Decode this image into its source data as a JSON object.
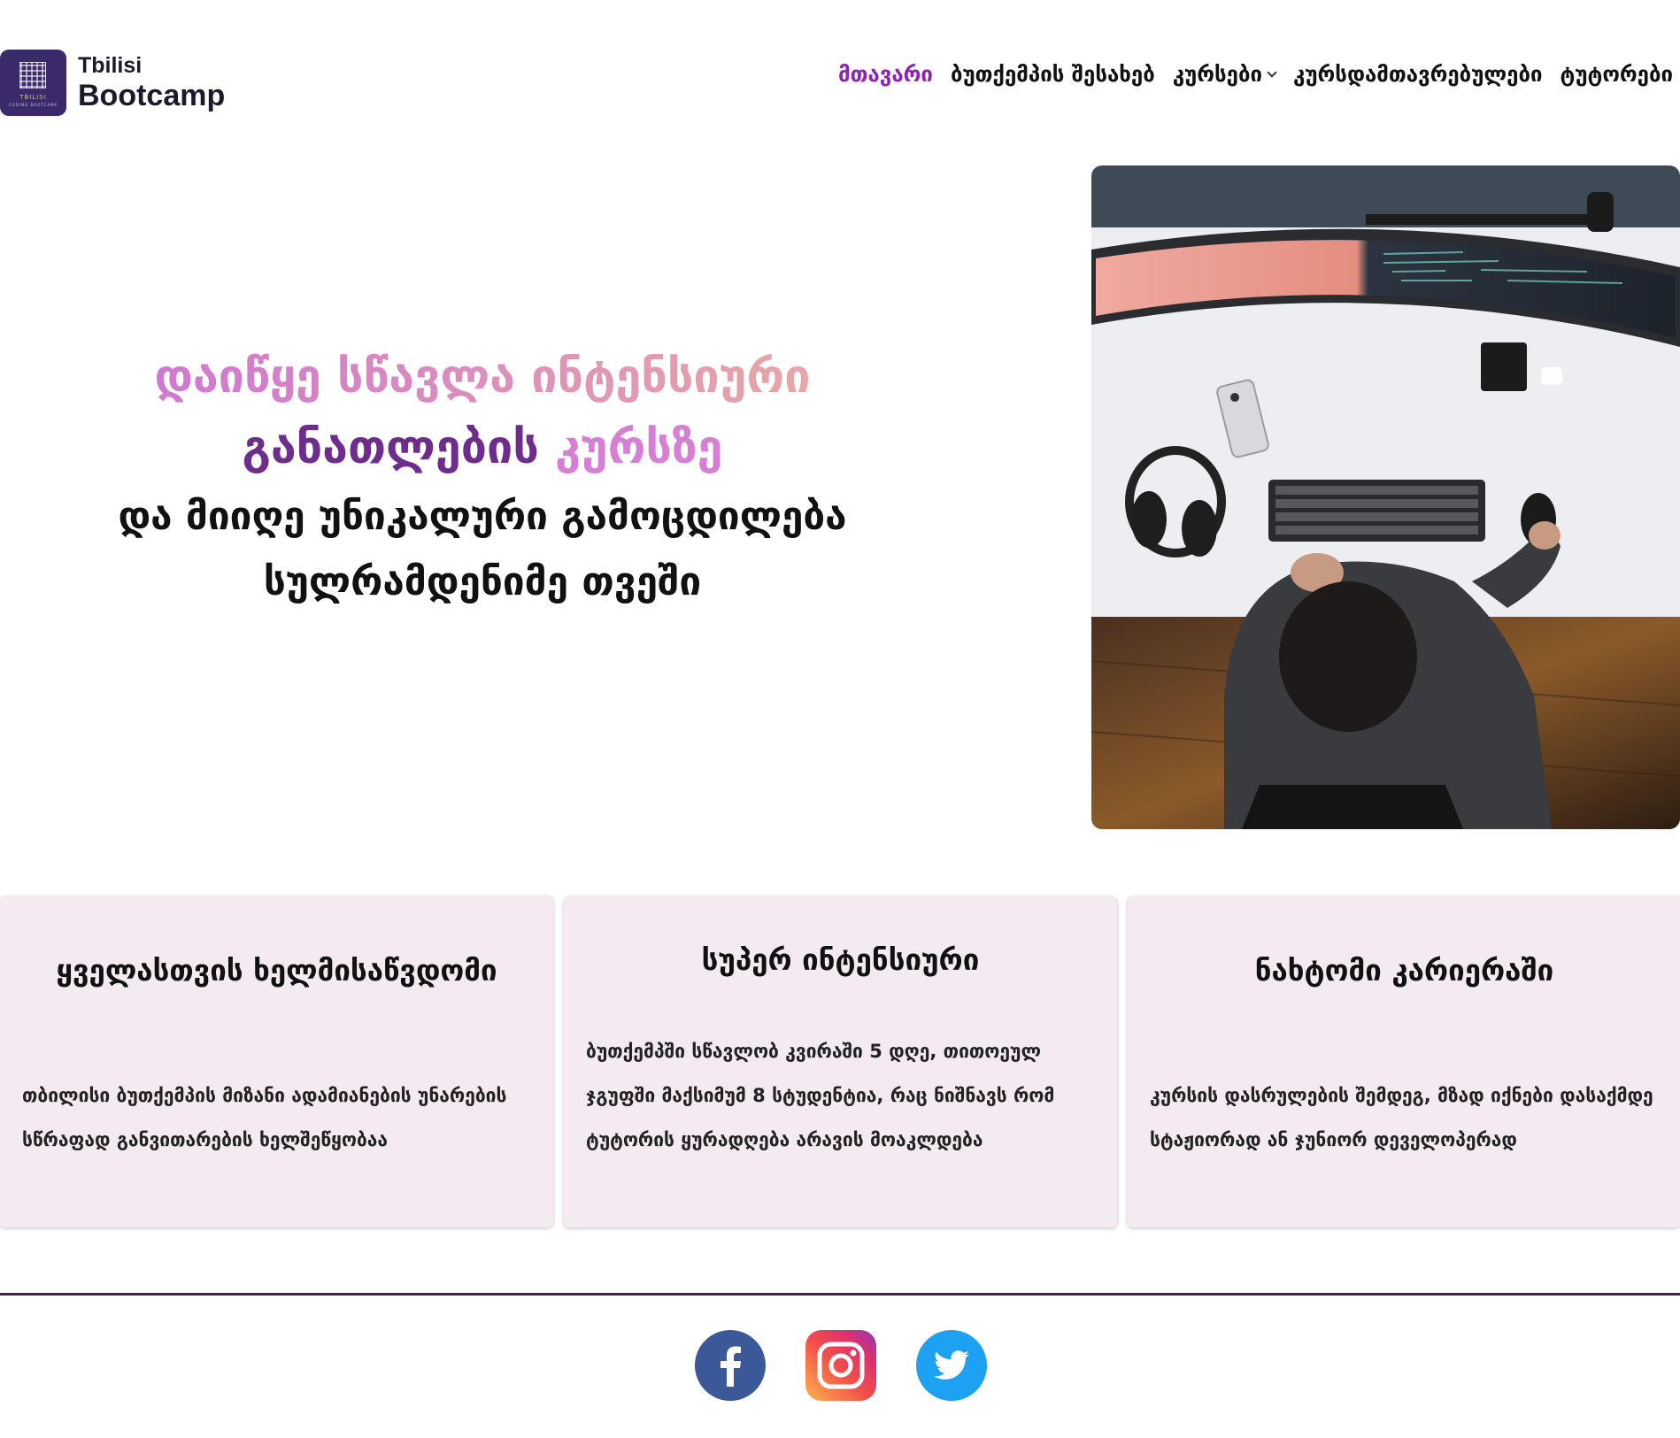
{
  "header": {
    "logo": {
      "line1": "Tbilisi",
      "line2": "Bootcamp",
      "badge_line1": "TBILISI",
      "badge_line2": "CODING BOOTCAMP"
    },
    "nav": [
      {
        "label": "მთავარი",
        "active": true
      },
      {
        "label": "ბუთქემპის შესახებ",
        "active": false
      },
      {
        "label": "კურსები",
        "active": false,
        "has_dropdown": true
      },
      {
        "label": "კურსდამთავრებულები",
        "active": false
      },
      {
        "label": "ტუტორები",
        "active": false
      }
    ]
  },
  "hero": {
    "line1_part1": "დაიწყე სწავლა ინტენსიური",
    "line2_part1": "განათლების",
    "line2_part2": "კურსზე",
    "line3": "და მიიღე უნიკალური გამოცდილება",
    "line4": "სულრამდენიმე თვეში",
    "image_icon": "workspace-photo-icon"
  },
  "cards": [
    {
      "title": "ყველასთვის ხელმისაწვდომი",
      "body": "თბილისი ბუთქემპის მიზანი ადამიანების უნარების სწრაფად განვითარების ხელშეწყობაა"
    },
    {
      "title": "სუპერ ინტენსიური",
      "body": "ბუთქემპში სწავლობ კვირაში 5 დღე, თითოეულ ჯგუფში მაქსიმუმ 8 სტუდენტია, რაც ნიშნავს რომ ტუტორის ყურადღება არავის მოაკლდება"
    },
    {
      "title": "ნახტომი კარიერაში",
      "body": "კურსის დასრულების შემდეგ, მზად იქნები დასაქმდე სტაჟიორად ან ჯუნიორ დეველოპერად"
    }
  ],
  "footer": {
    "socials": [
      {
        "name": "facebook-icon",
        "color": "#3b5998"
      },
      {
        "name": "instagram-icon",
        "color": "#e1306c"
      },
      {
        "name": "twitter-icon",
        "color": "#1da1f2"
      }
    ]
  },
  "colors": {
    "accent": "#8d22b4",
    "card_bg": "#f4eaf1",
    "divider": "#4a1f52",
    "logo_bg": "#3a2a6a"
  }
}
